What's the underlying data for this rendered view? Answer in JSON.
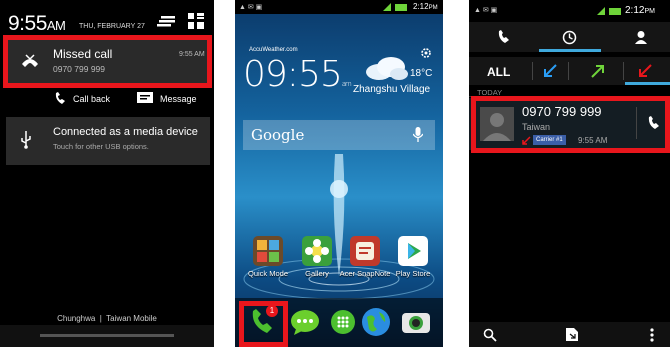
{
  "panel1": {
    "time": "9:55",
    "ampm": "AM",
    "date": "THU, FEBRUARY 27",
    "missed_call": {
      "title": "Missed call",
      "number": "0970 799 999",
      "time": "9:55 AM",
      "callback_label": "Call back",
      "message_label": "Message"
    },
    "usb": {
      "title": "Connected as a media device",
      "subtitle": "Touch for other USB options."
    },
    "carriers": "Chunghwa  |  Taiwan Mobile"
  },
  "panel2": {
    "status_time": "2:12",
    "status_ampm": "PM",
    "weather_brand": "AccuWeather.com",
    "clock": "09:55",
    "clock_ampm": "am",
    "temperature": "18°C",
    "location": "Zhangshu Village",
    "search_placeholder": "Google",
    "apps": [
      {
        "label": "Quick Mode",
        "icon": "quick-mode-icon",
        "color": "#6b4a2a"
      },
      {
        "label": "Gallery",
        "icon": "gallery-icon",
        "color": "#3aa03c"
      },
      {
        "label": "Acer SnapNote",
        "icon": "snapnote-icon",
        "color": "#c0392b"
      },
      {
        "label": "Play Store",
        "icon": "play-store-icon",
        "color": "#ffffff"
      }
    ],
    "phone_badge": "1",
    "colors": {
      "highlight": "#e8161c",
      "dock_phone": "#4cbf2f"
    }
  },
  "panel3": {
    "status_time": "2:12",
    "status_ampm": "PM",
    "filter_all": "ALL",
    "section": "TODAY",
    "call_number": "0970 799 999",
    "call_location": "Taiwan",
    "carrier_badge": "Carrier #1",
    "call_time": "9:55 AM",
    "colors": {
      "incoming": "#2a9df4",
      "outgoing": "#6fd43a",
      "missed": "#e8161c",
      "accent": "#3fa9dc"
    }
  }
}
